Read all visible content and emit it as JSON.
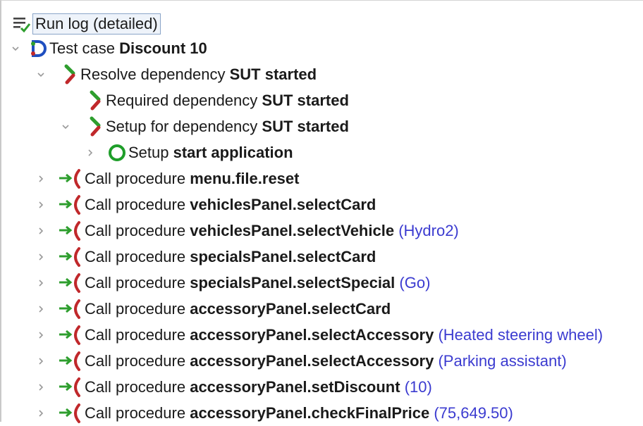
{
  "root": {
    "label": "Run log (detailed)",
    "icon": "run-log-icon"
  },
  "testcase": {
    "prefix": "Test case",
    "name": "Discount 10",
    "icon": "test-case-icon"
  },
  "resolve": {
    "prefix": "Resolve dependency",
    "name": "SUT started",
    "icon": "dependency-icon"
  },
  "required": {
    "prefix": "Required dependency",
    "name": "SUT started",
    "icon": "dependency-icon"
  },
  "setup_dep": {
    "prefix": "Setup for dependency",
    "name": "SUT started",
    "icon": "dependency-icon"
  },
  "setup": {
    "prefix": "Setup",
    "name": "start application",
    "icon": "setup-icon"
  },
  "calls": [
    {
      "prefix": "Call procedure",
      "name": "menu.file.reset",
      "arg": ""
    },
    {
      "prefix": "Call procedure",
      "name": "vehiclesPanel.selectCard",
      "arg": ""
    },
    {
      "prefix": "Call procedure",
      "name": "vehiclesPanel.selectVehicle",
      "arg": "(Hydro2)"
    },
    {
      "prefix": "Call procedure",
      "name": "specialsPanel.selectCard",
      "arg": ""
    },
    {
      "prefix": "Call procedure",
      "name": "specialsPanel.selectSpecial",
      "arg": "(Go)"
    },
    {
      "prefix": "Call procedure",
      "name": "accessoryPanel.selectCard",
      "arg": ""
    },
    {
      "prefix": "Call procedure",
      "name": "accessoryPanel.selectAccessory",
      "arg": "(Heated steering wheel)"
    },
    {
      "prefix": "Call procedure",
      "name": "accessoryPanel.selectAccessory",
      "arg": "(Parking assistant)"
    },
    {
      "prefix": "Call procedure",
      "name": "accessoryPanel.setDiscount",
      "arg": "(10)"
    },
    {
      "prefix": "Call procedure",
      "name": "accessoryPanel.checkFinalPrice",
      "arg": "(75,649.50)"
    }
  ]
}
